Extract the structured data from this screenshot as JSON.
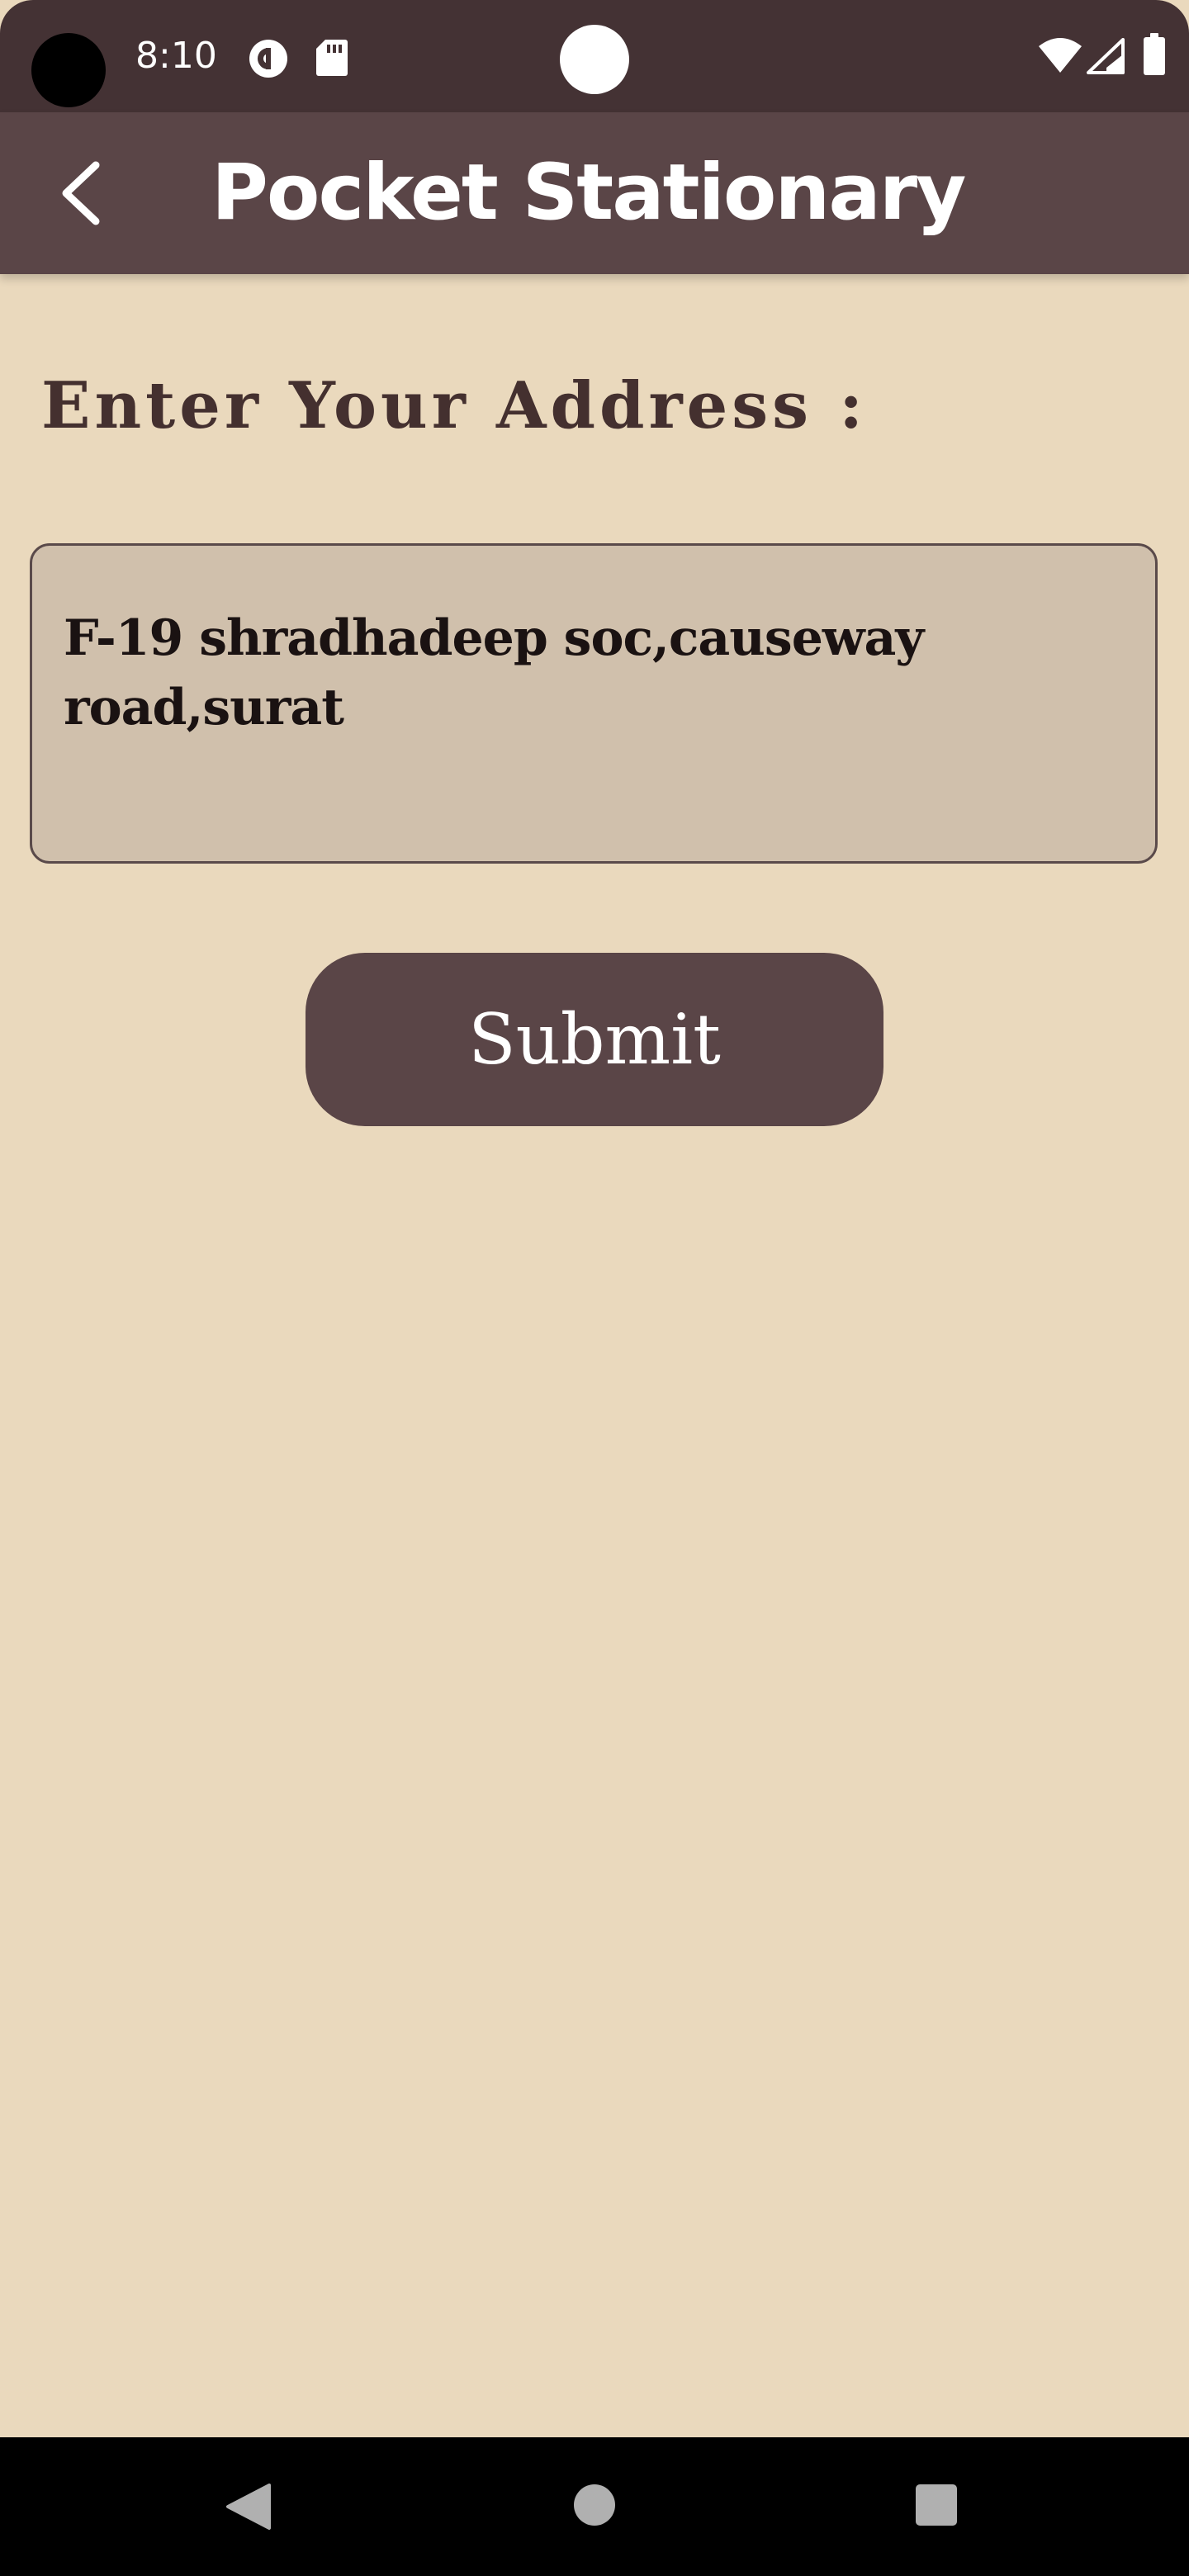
{
  "status_bar": {
    "time": "8:10",
    "icons": [
      "camera-cutout",
      "pocket-casts-icon",
      "sd-card-icon",
      "front-camera-dot",
      "wifi-icon",
      "cell-signal-icon",
      "battery-icon"
    ],
    "background": "#443234"
  },
  "app_bar": {
    "title": "Pocket Stationary",
    "back_icon": "back-arrow-icon",
    "background": "#5A4547"
  },
  "form": {
    "prompt_label": "Enter Your Address :",
    "address_value": "F-19 shradhadeep soc,causeway road,surat",
    "field_background": "#D0C0AC",
    "submit_label": "Submit"
  },
  "navigation_bar": {
    "buttons": [
      "back-triangle-icon",
      "home-circle-icon",
      "recents-square-icon"
    ]
  },
  "colors": {
    "page_background": "#EAD9BD",
    "accent": "#5A4547",
    "label_text": "#44302F"
  }
}
